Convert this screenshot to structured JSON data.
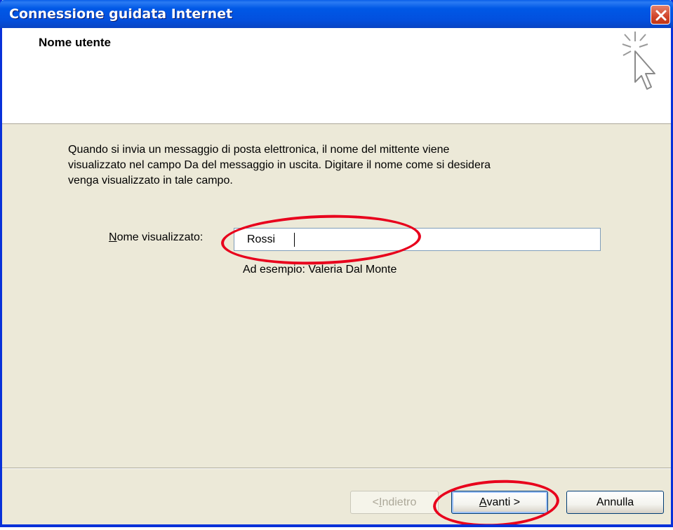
{
  "window": {
    "title": "Connessione guidata Internet",
    "close_icon": "close-icon"
  },
  "header": {
    "title": "Nome utente",
    "icon": "cursor-sparkle-icon"
  },
  "body": {
    "description": "Quando si invia un messaggio di posta elettronica, il nome del mittente viene\nvisualizzato nel campo Da del messaggio in uscita. Digitare il nome come si desidera\nvenga visualizzato in tale campo.",
    "field_label_mnemonic": "N",
    "field_label_rest": "ome visualizzato:",
    "field_value": "Rossi",
    "example": "Ad esempio: Valeria Dal Monte"
  },
  "buttons": {
    "back_prefix": "< ",
    "back_mnemonic": "I",
    "back_rest": "ndietro",
    "next_mnemonic": "A",
    "next_rest": "vanti >",
    "cancel": "Annulla"
  },
  "colors": {
    "annotation": "#E8001C",
    "titlebar": "#0058E6",
    "dialog_bg": "#ECE9D8"
  }
}
